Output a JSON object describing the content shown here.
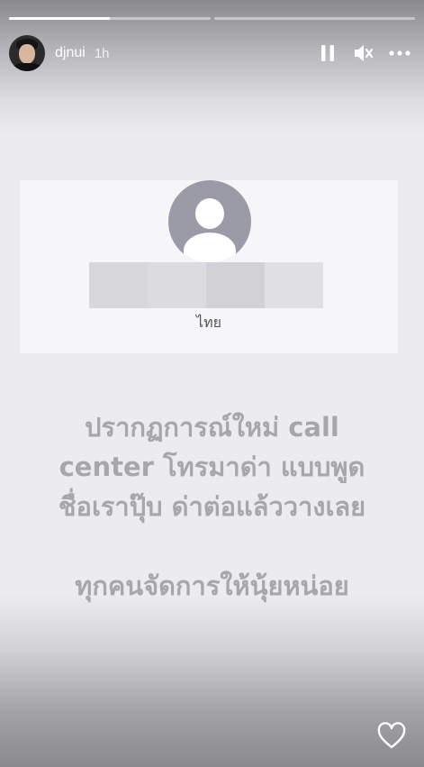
{
  "story": {
    "progress": [
      0.5,
      0
    ],
    "username": "djnui",
    "time": "1h"
  },
  "card": {
    "country": "ไทย"
  },
  "caption": {
    "line1": "ปรากฏการณ์ใหม่ call",
    "line2": "center โทรมาด่า แบบพูด",
    "line3": "ชื่อเราปุ๊บ ด่าต่อแล้ววางเลย",
    "line4": "ทุกคนจัดการให้นุ้ยหน่อย"
  },
  "icons": {
    "pause": "pause-icon",
    "mute": "speaker-muted-icon",
    "more": "more-dots-icon",
    "like": "heart-icon"
  }
}
